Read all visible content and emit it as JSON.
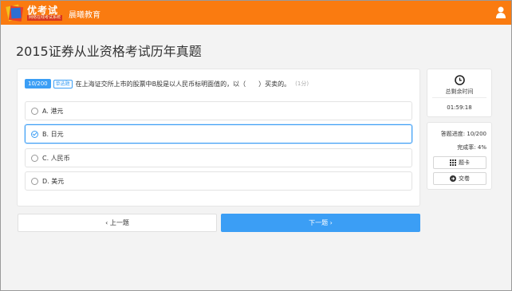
{
  "header": {
    "logo_text": "优考试",
    "logo_subtext": "网络在线考试系统",
    "org_name": "晨曦教育",
    "accent_color": "#fa7b10"
  },
  "page": {
    "title": "2015证券从业资格考试历年真题"
  },
  "question": {
    "number": "10/200",
    "type": "单选题",
    "text": "在上海证交所上市的股票中B股是以人民币标明面值的，以（　　）买卖的。",
    "score": "(1分)",
    "options": [
      {
        "label": "A. 港元",
        "selected": false
      },
      {
        "label": "B. 日元",
        "selected": true
      },
      {
        "label": "C. 人民币",
        "selected": false
      },
      {
        "label": "D. 美元",
        "selected": false
      }
    ]
  },
  "nav": {
    "prev_label": "‹ 上一题",
    "next_label": "下一题 ›"
  },
  "timer": {
    "label": "总剩余时间",
    "value": "01:59:18",
    "icon": "clock-icon"
  },
  "status": {
    "progress_label": "答题进度: 10/200",
    "completion_label": "完成率:  4%",
    "answer_card_label": "题卡",
    "submit_label": "交卷",
    "primary_color": "#3b9ef5"
  }
}
